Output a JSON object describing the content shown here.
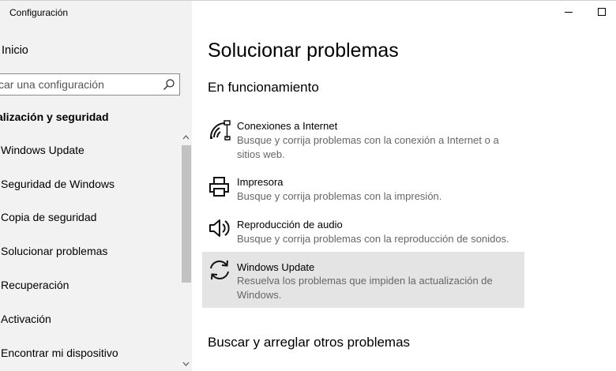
{
  "window": {
    "title": "Configuración"
  },
  "sidebar": {
    "home_label": "Inicio",
    "search_placeholder": "scar una configuración",
    "section_heading": "alización y seguridad",
    "items": [
      {
        "label": "Windows Update",
        "icon": "refresh-icon"
      },
      {
        "label": "Seguridad de Windows",
        "icon": "shield-icon"
      },
      {
        "label": "Copia de seguridad",
        "icon": "backup-icon"
      },
      {
        "label": "Solucionar problemas",
        "icon": "wrench-icon"
      },
      {
        "label": "Recuperación",
        "icon": "history-icon"
      },
      {
        "label": "Activación",
        "icon": "check-circle-icon"
      },
      {
        "label": "Encontrar mi dispositivo",
        "icon": "locate-icon"
      }
    ]
  },
  "main": {
    "title": "Solucionar problemas",
    "section_running": "En funcionamiento",
    "troubleshooters": [
      {
        "title": "Conexiones a Internet",
        "description": "Busque y corrija problemas con la conexión a Internet o a sitios web.",
        "icon": "network-icon",
        "selected": false
      },
      {
        "title": "Impresora",
        "description": "Busque y corrija problemas con la impresión.",
        "icon": "printer-icon",
        "selected": false
      },
      {
        "title": "Reproducción de audio",
        "description": "Busque y corrija problemas con la reproducción de sonidos.",
        "icon": "speaker-icon",
        "selected": false
      },
      {
        "title": "Windows Update",
        "description": "Resuelva los problemas que impiden la actualización de Windows.",
        "icon": "refresh-icon",
        "selected": true
      }
    ],
    "section_other": "Buscar y arreglar otros problemas"
  },
  "colors": {
    "sidebar_bg": "#f2f2f2",
    "selected_bg": "#e4e4e4",
    "description_text": "#666666",
    "scroll_thumb": "#c2c2c2"
  }
}
